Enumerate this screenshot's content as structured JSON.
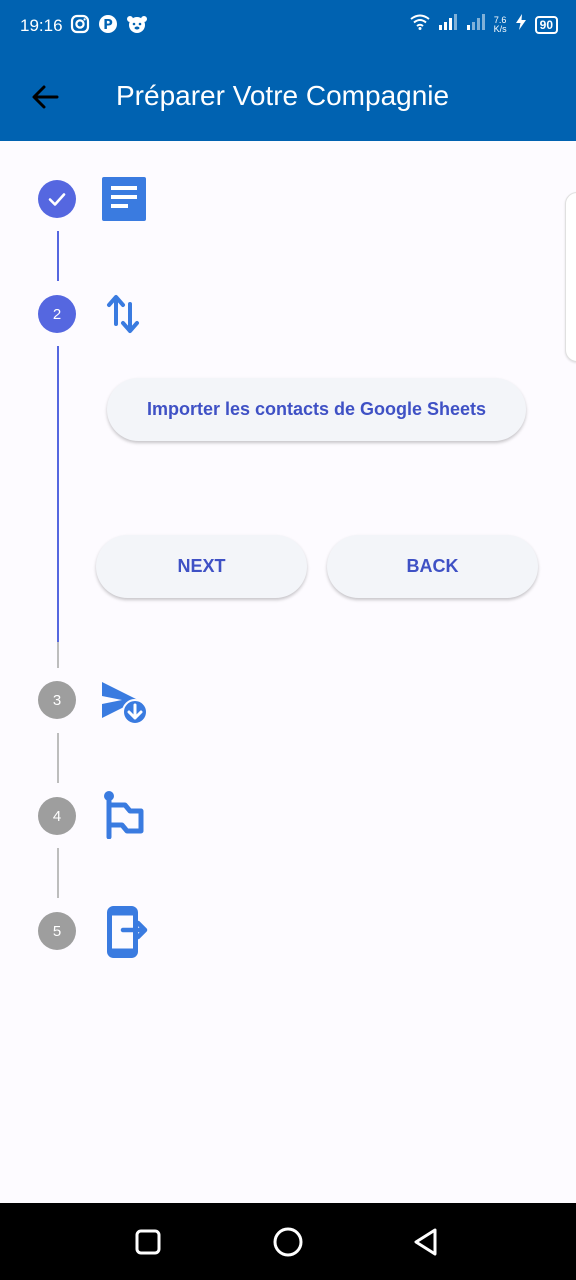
{
  "status_bar": {
    "time": "19:16",
    "net_speed_value": "7.6",
    "net_speed_unit": "K/s",
    "battery": "90",
    "icons": [
      "instagram-icon",
      "p-icon",
      "face-icon",
      "wifi-icon",
      "signal-icon",
      "signal-icon-2",
      "charging-icon"
    ]
  },
  "appbar": {
    "title": "Préparer Votre Compagnie",
    "back_icon": "arrow-left-icon"
  },
  "stepper": {
    "active_color": "#5567e0",
    "inactive_color": "#9e9e9e",
    "icon_color": "#3a7be0",
    "steps": [
      {
        "number": "",
        "state": "completed",
        "icon": "document-icon"
      },
      {
        "number": "2",
        "state": "active",
        "icon": "swap-vertical-icon"
      },
      {
        "number": "3",
        "state": "inactive",
        "icon": "send-download-icon"
      },
      {
        "number": "4",
        "state": "inactive",
        "icon": "flag-icon"
      },
      {
        "number": "5",
        "state": "inactive",
        "icon": "device-exit-icon"
      }
    ],
    "import_button": "Importer les contacts de Google Sheets",
    "next_button": "NEXT",
    "back_button": "BACK"
  },
  "navigation_bar": {
    "buttons": [
      "recents-icon",
      "home-icon",
      "back-icon"
    ]
  }
}
